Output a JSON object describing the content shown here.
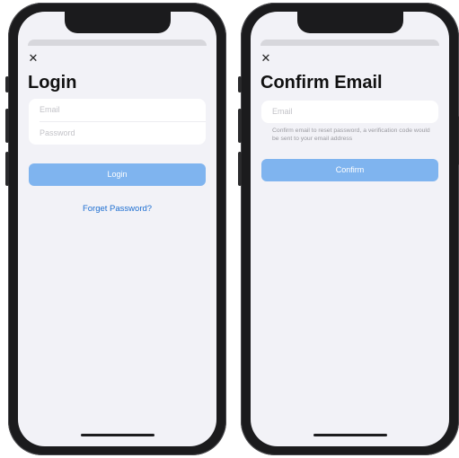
{
  "login_screen": {
    "close_icon": "close-icon",
    "title": "Login",
    "email_placeholder": "Email",
    "password_placeholder": "Password",
    "login_label": "Login",
    "forget_label": "Forget Password?"
  },
  "confirm_screen": {
    "close_icon": "close-icon",
    "title": "Confirm Email",
    "email_placeholder": "Email",
    "helper_text": "Confirm email to reset password, a verification code would be sent to your email address",
    "confirm_label": "Confirm"
  },
  "colors": {
    "accent_button": "#7fb4ef",
    "link": "#1f6fd1",
    "background": "#f2f2f7"
  }
}
